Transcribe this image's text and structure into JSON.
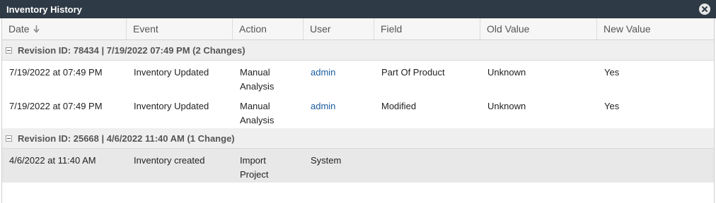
{
  "window": {
    "title": "Inventory History"
  },
  "columns": {
    "date": "Date",
    "event": "Event",
    "action": "Action",
    "user": "User",
    "field": "Field",
    "old_value": "Old Value",
    "new_value": "New Value"
  },
  "groups": [
    {
      "label": "Revision ID: 78434 | 7/19/2022 07:49 PM (2 Changes)",
      "rows": [
        {
          "date": "7/19/2022 at 07:49 PM",
          "event": "Inventory Updated",
          "action_line1": "Manual",
          "action_line2": "Analysis",
          "user": "admin",
          "field": "Part Of Product",
          "old_value": "Unknown",
          "new_value": "Yes"
        },
        {
          "date": "7/19/2022 at 07:49 PM",
          "event": "Inventory Updated",
          "action_line1": "Manual",
          "action_line2": "Analysis",
          "user": "admin",
          "field": "Modified",
          "old_value": "Unknown",
          "new_value": "Yes"
        }
      ]
    },
    {
      "label": "Revision ID: 25668 | 4/6/2022 11:40 AM (1 Change)",
      "rows": [
        {
          "date": "4/6/2022 at 11:40 AM",
          "event": "Inventory created",
          "action_line1": "Import",
          "action_line2": "Project",
          "user": "System",
          "field": "",
          "old_value": "",
          "new_value": ""
        }
      ]
    }
  ],
  "colors": {
    "titlebar": "#2e3a45",
    "link": "#1a5a9e",
    "selected_row": "#e8e8e8"
  },
  "icons": {
    "close": "close-circle-icon",
    "sort": "sort-down-arrow-icon",
    "collapse": "collapse-minus-icon"
  }
}
